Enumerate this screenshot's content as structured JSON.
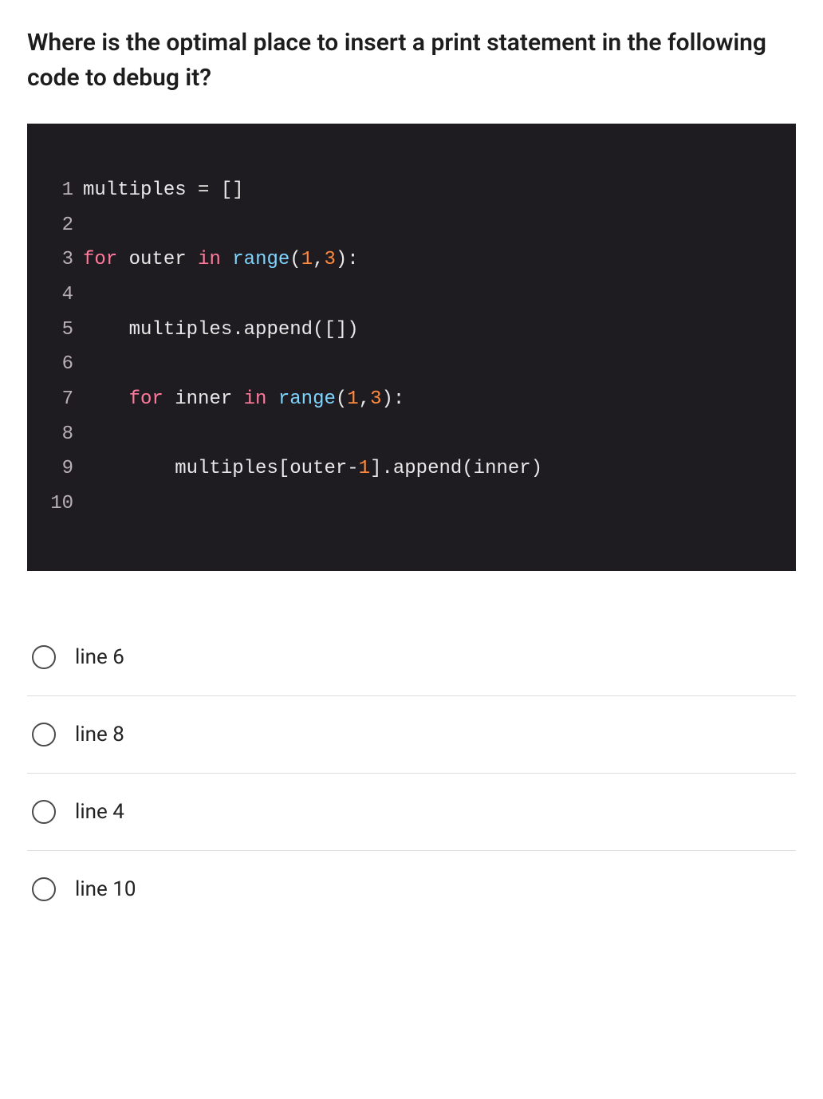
{
  "question": "Where is the optimal place to insert a print statement in the following code to debug it?",
  "code": {
    "lines": [
      {
        "n": "1",
        "tokens": [
          {
            "t": "multiples = []",
            "c": "plain"
          }
        ]
      },
      {
        "n": "2",
        "tokens": []
      },
      {
        "n": "3",
        "tokens": [
          {
            "t": "for",
            "c": "kw"
          },
          {
            "t": " outer ",
            "c": "plain"
          },
          {
            "t": "in",
            "c": "kw"
          },
          {
            "t": " ",
            "c": "plain"
          },
          {
            "t": "range",
            "c": "fn"
          },
          {
            "t": "(",
            "c": "plain"
          },
          {
            "t": "1",
            "c": "num"
          },
          {
            "t": ",",
            "c": "plain"
          },
          {
            "t": "3",
            "c": "num"
          },
          {
            "t": "):",
            "c": "plain"
          }
        ]
      },
      {
        "n": "4",
        "tokens": []
      },
      {
        "n": "5",
        "tokens": [
          {
            "t": "    multiples.append([])",
            "c": "plain"
          }
        ]
      },
      {
        "n": "6",
        "tokens": []
      },
      {
        "n": "7",
        "tokens": [
          {
            "t": "    ",
            "c": "plain"
          },
          {
            "t": "for",
            "c": "kw"
          },
          {
            "t": " inner ",
            "c": "plain"
          },
          {
            "t": "in",
            "c": "kw"
          },
          {
            "t": " ",
            "c": "plain"
          },
          {
            "t": "range",
            "c": "fn"
          },
          {
            "t": "(",
            "c": "plain"
          },
          {
            "t": "1",
            "c": "num"
          },
          {
            "t": ",",
            "c": "plain"
          },
          {
            "t": "3",
            "c": "num"
          },
          {
            "t": "):",
            "c": "plain"
          }
        ]
      },
      {
        "n": "8",
        "tokens": []
      },
      {
        "n": "9",
        "tokens": [
          {
            "t": "        multiples[outer-",
            "c": "plain"
          },
          {
            "t": "1",
            "c": "num"
          },
          {
            "t": "].append(inner)",
            "c": "plain"
          }
        ]
      },
      {
        "n": "10",
        "tokens": []
      }
    ]
  },
  "options": [
    {
      "label": "line 6"
    },
    {
      "label": "line 8"
    },
    {
      "label": "line 4"
    },
    {
      "label": "line 10"
    }
  ]
}
